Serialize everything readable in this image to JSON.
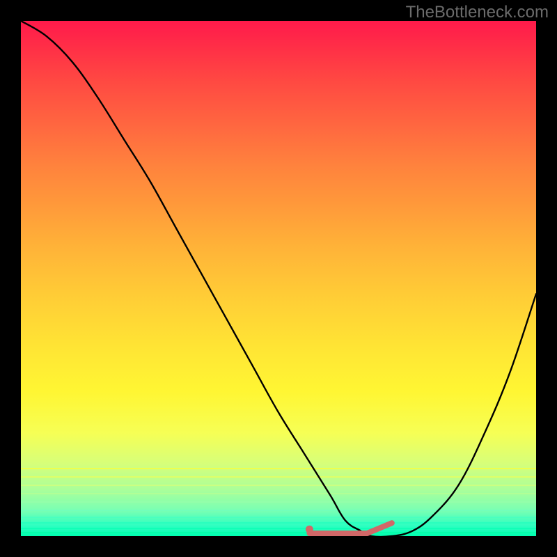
{
  "watermark": "TheBottleneck.com",
  "colors": {
    "black_frame": "#000000",
    "curve": "#000000",
    "highlight": "#d16868",
    "gradient_top": "#ff1a4b",
    "gradient_bottom": "#00ffb0"
  },
  "chart_data": {
    "type": "line",
    "title": "",
    "xlabel": "",
    "ylabel": "",
    "x": [
      0,
      5,
      10,
      15,
      20,
      25,
      30,
      35,
      40,
      45,
      50,
      55,
      60,
      63,
      66,
      68,
      72,
      76,
      80,
      85,
      90,
      95,
      100
    ],
    "values": [
      100,
      97,
      92,
      85,
      77,
      69,
      60,
      51,
      42,
      33,
      24,
      16,
      8,
      3,
      1,
      0,
      0,
      1,
      4,
      10,
      20,
      32,
      47
    ],
    "xlim": [
      0,
      100
    ],
    "ylim": [
      0,
      100
    ],
    "highlight_segment": {
      "x_start": 56,
      "x_end": 72,
      "y": 0,
      "end_rise_to_y": 2
    },
    "highlight_dot": {
      "x": 56,
      "y": 0.5
    },
    "annotations": []
  }
}
